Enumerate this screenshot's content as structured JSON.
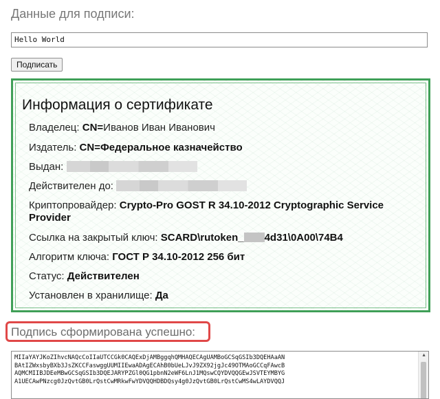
{
  "form": {
    "data_label": "Данные для подписи:",
    "data_value": "Hello World",
    "sign_button": "Подписать"
  },
  "certificate": {
    "title": "Информация о сертификате",
    "owner_label": "Владелец:",
    "owner_prefix": "CN=",
    "owner_value": "Иванов Иван Иванович",
    "issuer_label": "Издатель:",
    "issuer_value": "CN=Федеральное казначейство",
    "issued_label": "Выдан:",
    "valid_to_label": "Действителен до:",
    "provider_label": "Криптопровайдер:",
    "provider_value_line1": "Crypto-Pro GOST R 34.10-2012 Cryptographic Service",
    "provider_value_line2": "Provider",
    "key_link_label": "Ссылка на закрытый ключ:",
    "key_link_prefix": "SCARD\\rutoken_",
    "key_link_suffix": "4d31\\0A00\\74B4",
    "algorithm_label": "Алгоритм ключа:",
    "algorithm_value": "ГОСТ Р 34.10-2012 256 бит",
    "status_label": "Статус:",
    "status_value": "Действителен",
    "store_label": "Установлен в хранилище:",
    "store_value": "Да"
  },
  "result": {
    "success_message": "Подпись сформирована успешно:",
    "signature_lines": "MIIaYAYJKoZIhvcNAQcCoIIaUTCCGk0CAQExDjAMBggqhQMHAQECAgUAMBoGCSqGSIb3DQEHAaAN\nBAtIZWxsbyBXb3JsZKCCFaswggUUMIIEwaADAgECAhB0bUeLJvJ9ZX92jgJc49OTMAoGCCqFAwcB\nAQMCMIIBJDEeMBwGCSqGSIb3DQEJARYPZGl0QG1pbnN2eWF6LnJ1MQswCQYDVQQGEwJSVTEYMBYG\nA1UECAwPNzcg0JzQvtGB0LrQstCwMRkwFwYDVQQHDBDQsy4g0JzQvtGB0LrQstCwMS4wLAYDVQQJ"
  },
  "colors": {
    "cert_border": "#3f9f57",
    "success_border": "#e04848"
  }
}
